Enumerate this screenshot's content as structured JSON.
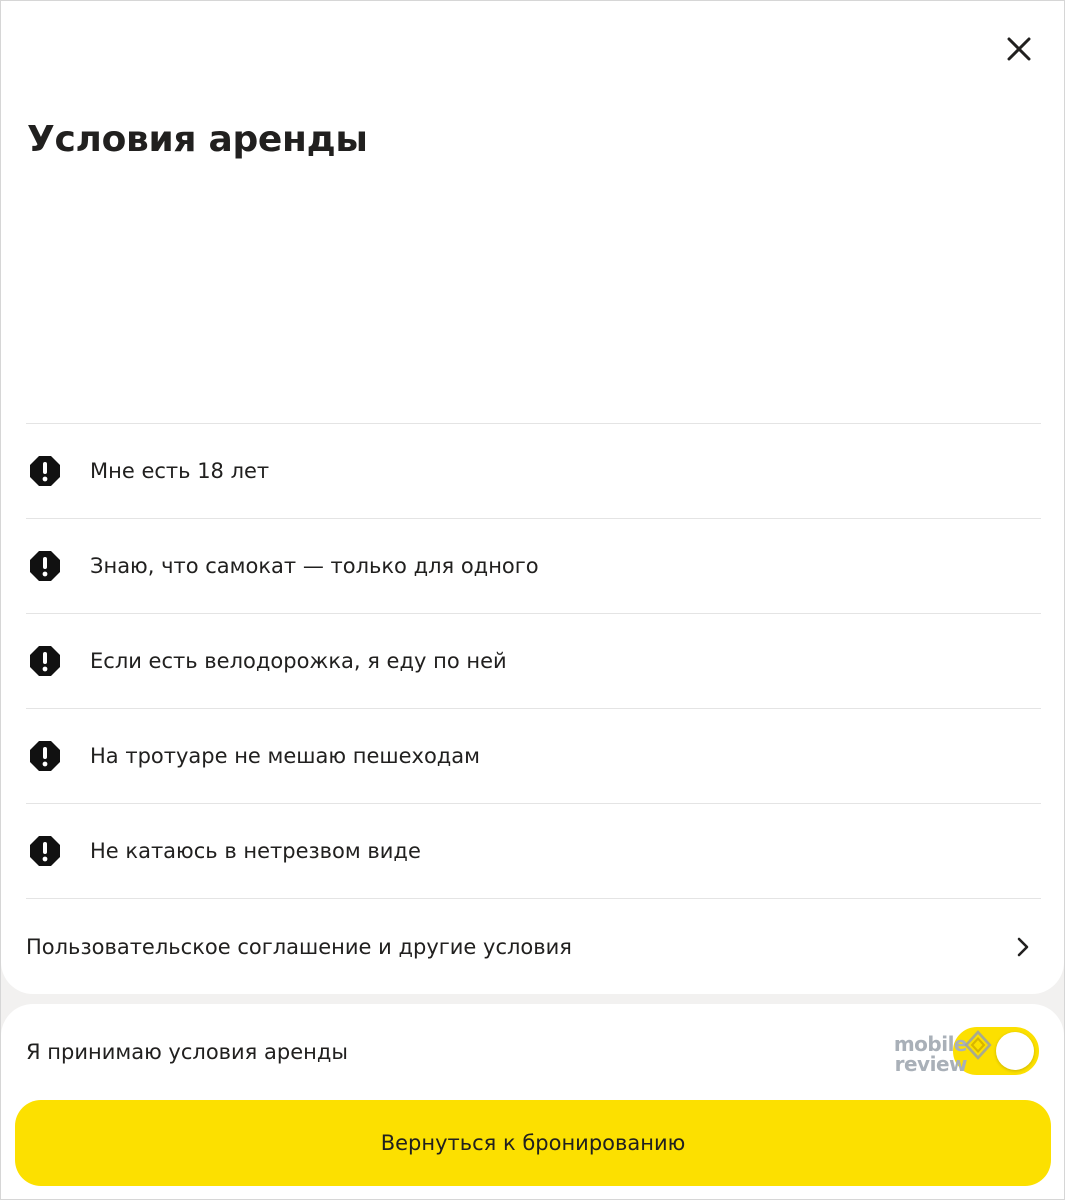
{
  "header": {
    "title": "Условия аренды",
    "close_icon": "close-icon"
  },
  "conditions": [
    {
      "text": "Мне есть 18 лет",
      "icon": "warning-icon"
    },
    {
      "text": "Знаю, что самокат — только для одного",
      "icon": "warning-icon"
    },
    {
      "text": "Если есть велодорожка, я еду по ней",
      "icon": "warning-icon"
    },
    {
      "text": "На тротуаре не мешаю пешеходам",
      "icon": "warning-icon"
    },
    {
      "text": "Не катаюсь в нетрезвом виде",
      "icon": "warning-icon"
    }
  ],
  "agreement": {
    "label": "Пользовательское соглашение и другие условия",
    "icon": "chevron-right-icon"
  },
  "accept": {
    "label": "Я принимаю условия аренды",
    "toggle_on": true
  },
  "watermark": {
    "line1": "mobile",
    "line2": "review"
  },
  "cta": {
    "label": "Вернуться к бронированию"
  },
  "colors": {
    "accent_yellow": "#fce000",
    "text": "#21201f",
    "divider": "#e4e4e4",
    "background": "#f2f1f0"
  }
}
